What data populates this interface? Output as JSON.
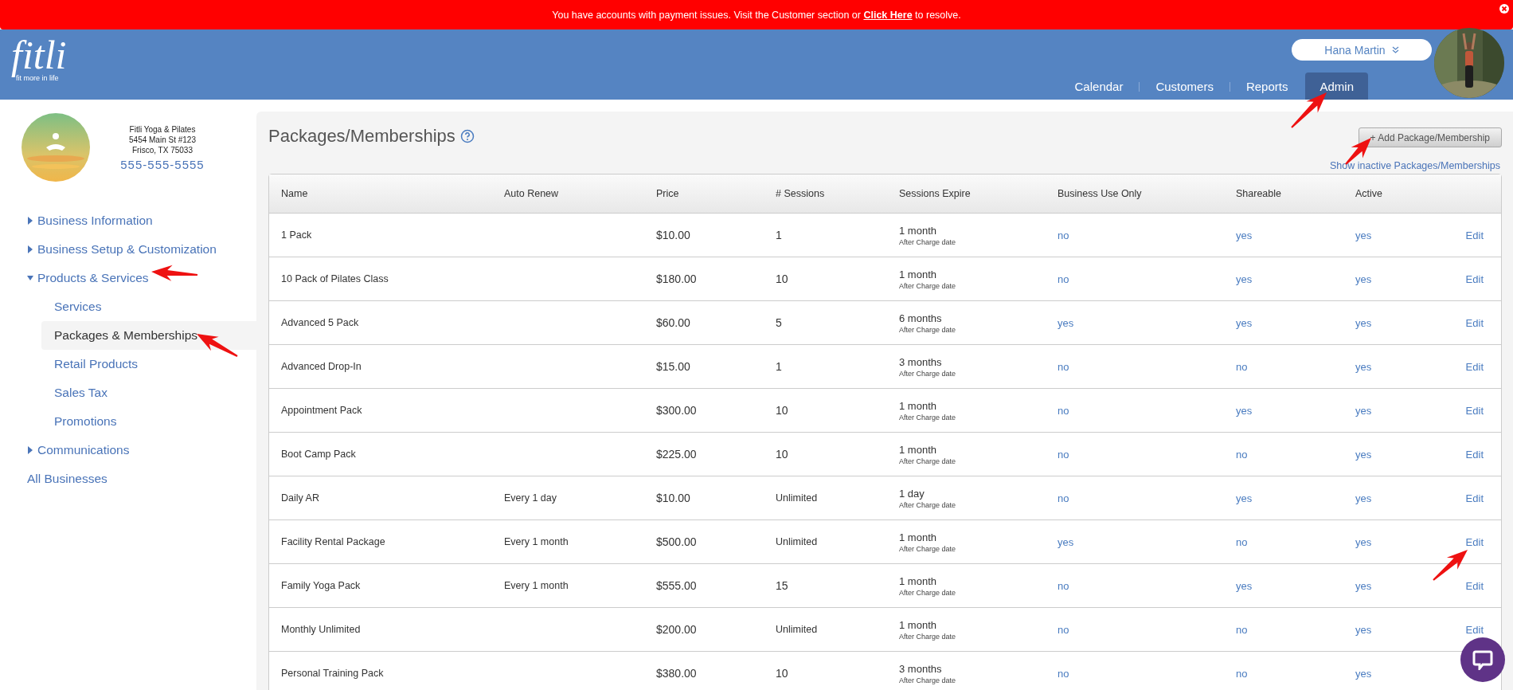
{
  "alert": {
    "before": "You have accounts with payment issues. Visit the Customer section or ",
    "link": "Click Here",
    "after": " to resolve."
  },
  "logo": {
    "wordmark": "fitli",
    "tagline": "fit more in life"
  },
  "user": {
    "name": "Hana Martin"
  },
  "nav_tabs": [
    {
      "label": "Calendar",
      "selected": false
    },
    {
      "label": "Customers",
      "selected": false
    },
    {
      "label": "Reports",
      "selected": false
    },
    {
      "label": "Admin",
      "selected": true
    }
  ],
  "business": {
    "name": "Fitli Yoga & Pilates",
    "address": "5454 Main St #123",
    "city": "Frisco, TX 75033",
    "phone": "555-555-5555"
  },
  "sidebar": {
    "items": [
      {
        "label": "Business Information",
        "expanded": false,
        "selected": false
      },
      {
        "label": "Business Setup & Customization",
        "expanded": false,
        "selected": false
      },
      {
        "label": "Products & Services",
        "expanded": true,
        "selected": false,
        "children": [
          {
            "label": "Services",
            "selected": false
          },
          {
            "label": "Packages & Memberships",
            "selected": true
          },
          {
            "label": "Retail Products",
            "selected": false
          },
          {
            "label": "Sales Tax",
            "selected": false
          },
          {
            "label": "Promotions",
            "selected": false
          }
        ]
      },
      {
        "label": "Communications",
        "expanded": false,
        "selected": false
      },
      {
        "label": "All Businesses",
        "kind": "link",
        "selected": false
      }
    ]
  },
  "page": {
    "title": "Packages/Memberships",
    "add_button": "+ Add Package/Membership",
    "inactive_link": "Show inactive Packages/Memberships"
  },
  "table": {
    "columns": [
      "Name",
      "Auto Renew",
      "Price",
      "# Sessions",
      "Sessions Expire",
      "Business Use Only",
      "Shareable",
      "Active"
    ],
    "rows": [
      {
        "name": "1 Pack",
        "price": "$10.00",
        "sessions": "1",
        "expire": "1 month",
        "expire_note": "After Charge date",
        "business_use": "no",
        "shareable": "yes",
        "active": "yes",
        "edit": "Edit"
      },
      {
        "name": "10 Pack of Pilates Class",
        "price": "$180.00",
        "sessions": "10",
        "expire": "1 month",
        "expire_note": "After Charge date",
        "business_use": "no",
        "shareable": "yes",
        "active": "yes",
        "edit": "Edit"
      },
      {
        "name": "Advanced 5 Pack",
        "price": "$60.00",
        "sessions": "5",
        "expire": "6 months",
        "expire_note": "After Charge date",
        "business_use": "yes",
        "shareable": "yes",
        "active": "yes",
        "edit": "Edit"
      },
      {
        "name": "Advanced Drop-In",
        "price": "$15.00",
        "sessions": "1",
        "expire": "3 months",
        "expire_note": "After Charge date",
        "business_use": "no",
        "shareable": "no",
        "active": "yes",
        "edit": "Edit"
      },
      {
        "name": "Appointment Pack",
        "price": "$300.00",
        "sessions": "10",
        "expire": "1 month",
        "expire_note": "After Charge date",
        "business_use": "no",
        "shareable": "yes",
        "active": "yes",
        "edit": "Edit"
      },
      {
        "name": "Boot Camp Pack",
        "price": "$225.00",
        "sessions": "10",
        "expire": "1 month",
        "expire_note": "After Charge date",
        "business_use": "no",
        "shareable": "no",
        "active": "yes",
        "edit": "Edit"
      },
      {
        "name": "Daily AR",
        "auto_renew": "Every 1 day",
        "price": "$10.00",
        "sessions": "Unlimited",
        "expire": "1 day",
        "expire_note": "After Charge date",
        "business_use": "no",
        "shareable": "yes",
        "active": "yes",
        "edit": "Edit"
      },
      {
        "name": "Facility Rental Package",
        "auto_renew": "Every 1 month",
        "price": "$500.00",
        "sessions": "Unlimited",
        "expire": "1 month",
        "expire_note": "After Charge date",
        "business_use": "yes",
        "shareable": "no",
        "active": "yes",
        "edit": "Edit"
      },
      {
        "name": "Family Yoga Pack",
        "auto_renew": "Every 1 month",
        "price": "$555.00",
        "sessions": "15",
        "expire": "1 month",
        "expire_note": "After Charge date",
        "business_use": "no",
        "shareable": "yes",
        "active": "yes",
        "edit": "Edit"
      },
      {
        "name": "Monthly Unlimited",
        "price": "$200.00",
        "sessions": "Unlimited",
        "expire": "1 month",
        "expire_note": "After Charge date",
        "business_use": "no",
        "shareable": "no",
        "active": "yes",
        "edit": "Edit"
      },
      {
        "name": "Personal Training Pack",
        "price": "$380.00",
        "sessions": "10",
        "expire": "3 months",
        "expire_note": "After Charge date",
        "business_use": "no",
        "shareable": "no",
        "active": "yes"
      }
    ]
  }
}
